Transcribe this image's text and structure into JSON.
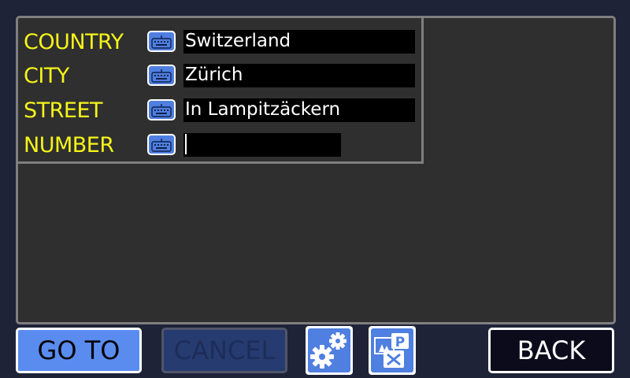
{
  "form": {
    "rows": [
      {
        "label": "COUNTRY",
        "value": "Switzerland",
        "icon": "keyboard-icon"
      },
      {
        "label": "CITY",
        "value": "Zürich",
        "icon": "keyboard-icon"
      },
      {
        "label": "STREET",
        "value": "In Lampitzäckern",
        "icon": "keyboard-icon"
      },
      {
        "label": "NUMBER",
        "value": "",
        "icon": "keyboard-icon"
      }
    ]
  },
  "toolbar": {
    "goto_label": "GO TO",
    "cancel_label": "CANCEL",
    "settings_icon": "gears-icon",
    "poi_icon": "poi-parking-icon",
    "back_label": "BACK"
  },
  "colors": {
    "background": "#1e2338",
    "panel": "#2f2f2f",
    "label": "#f5f51a",
    "accent": "#4f7fe0",
    "field": "#000000"
  }
}
